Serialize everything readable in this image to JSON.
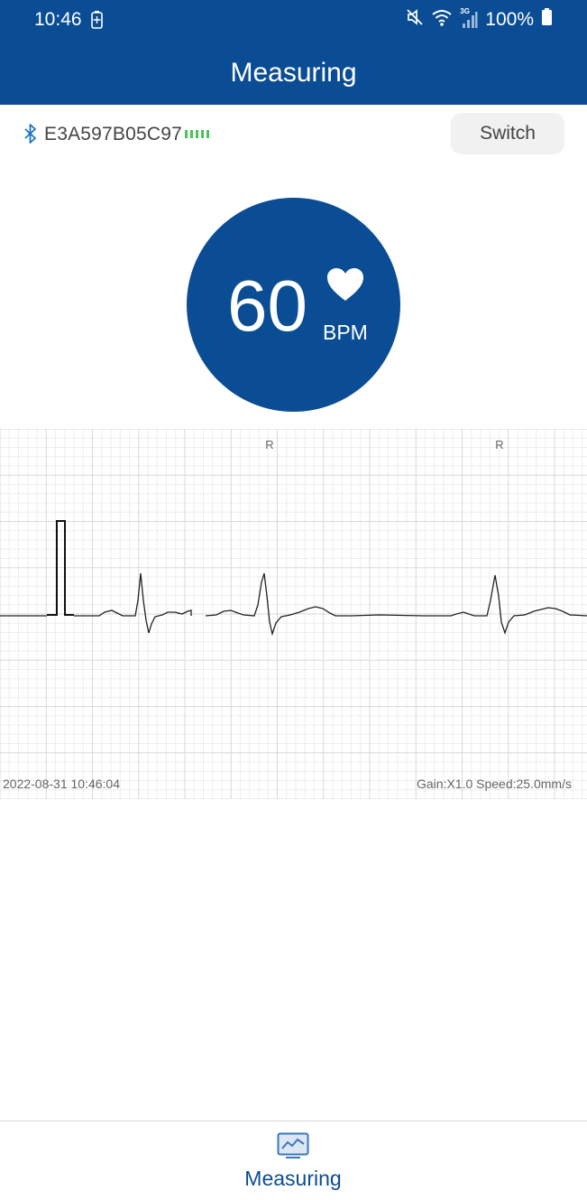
{
  "status_bar": {
    "time": "10:46",
    "battery_percent": "100%",
    "network_label": "3G"
  },
  "header": {
    "title": "Measuring"
  },
  "device": {
    "id": "E3A597B05C97",
    "battery_level": 1.0,
    "switch_label": "Switch"
  },
  "heart_rate": {
    "value": "60",
    "unit": "BPM"
  },
  "ecg": {
    "r_markers": [
      "R",
      "R"
    ],
    "timestamp": "2022-08-31 10:46:04",
    "settings": "Gain:X1.0 Speed:25.0mm/s"
  },
  "bottom_nav": {
    "label": "Measuring"
  },
  "colors": {
    "primary": "#0a4d94",
    "battery_green": "#4cc25a"
  },
  "icons": {
    "bluetooth": "bluetooth-icon",
    "heart": "heart-icon",
    "nav": "chart-monitor-icon",
    "mute": "mute-icon",
    "wifi": "wifi-icon",
    "signal": "signal-icon",
    "battery": "battery-icon",
    "charging": "charging-icon"
  }
}
